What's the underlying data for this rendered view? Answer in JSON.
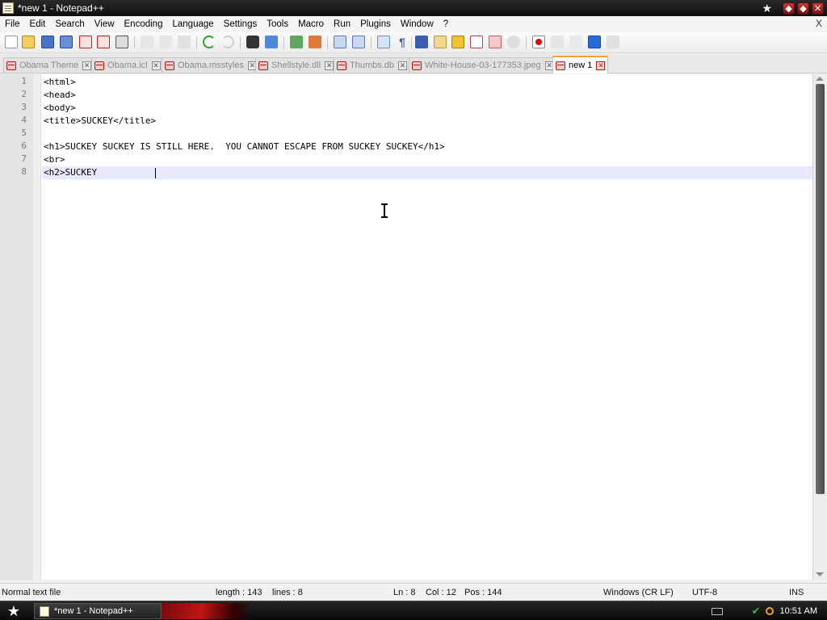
{
  "window": {
    "title": "*new 1 - Notepad++",
    "star_glyph": "★",
    "btn_restore": "⬦",
    "btn_max": "⬦",
    "btn_close": "✕"
  },
  "menu": {
    "items": [
      "File",
      "Edit",
      "Search",
      "View",
      "Encoding",
      "Language",
      "Settings",
      "Tools",
      "Macro",
      "Run",
      "Plugins",
      "Window",
      "?"
    ],
    "close_doc": "X"
  },
  "toolbar": {
    "icons": [
      "new-icon",
      "open-icon",
      "save-icon",
      "save-all-icon",
      "close-icon",
      "close-all-icon",
      "print-icon",
      "cut-icon",
      "copy-icon",
      "paste-icon",
      "undo-icon",
      "redo-icon",
      "find-icon",
      "replace-icon",
      "zoom-in-icon",
      "zoom-out-icon",
      "sync-v-icon",
      "sync-h-icon",
      "wrap-icon",
      "show-all-chars-icon",
      "indent-guide-icon",
      "udl-icon",
      "doc-map-icon",
      "function-list-icon",
      "folder-workspace-icon",
      "monitor-icon",
      "record-macro-icon",
      "stop-macro-icon",
      "play-macro-icon",
      "run-multiple-icon",
      "save-macro-icon"
    ]
  },
  "tabs": [
    {
      "label": "Obama Theme",
      "active": false
    },
    {
      "label": "Obama.icl",
      "active": false
    },
    {
      "label": "Obama.msstyles",
      "active": false
    },
    {
      "label": "Shellstyle.dll",
      "active": false
    },
    {
      "label": "Thumbs.db",
      "active": false
    },
    {
      "label": "White-House-03-177353.jpeg",
      "active": false
    },
    {
      "label": "new 1",
      "active": true
    }
  ],
  "tab_close_glyph": "✕",
  "editor": {
    "line_numbers": [
      "1",
      "2",
      "3",
      "4",
      "5",
      "6",
      "7",
      "8"
    ],
    "lines": [
      "<html>",
      "<head>",
      "<body>",
      "<title>SUCKEY</title>",
      "",
      "<h1>SUCKEY SUCKEY IS STILL HERE.  YOU CANNOT ESCAPE FROM SUCKEY SUCKEY</h1>",
      "<br>",
      "<h2>SUCKEY "
    ]
  },
  "status": {
    "file_type": "Normal text file",
    "length": "length : 143",
    "lines": "lines : 8",
    "ln": "Ln : 8",
    "col": "Col : 12",
    "pos": "Pos : 144",
    "eol": "Windows (CR LF)",
    "encoding": "UTF-8",
    "mode": "INS"
  },
  "taskbar": {
    "start_glyph": "★",
    "task_label": "*new 1 - Notepad++",
    "clock": "10:51 AM",
    "check_glyph": "✔"
  }
}
